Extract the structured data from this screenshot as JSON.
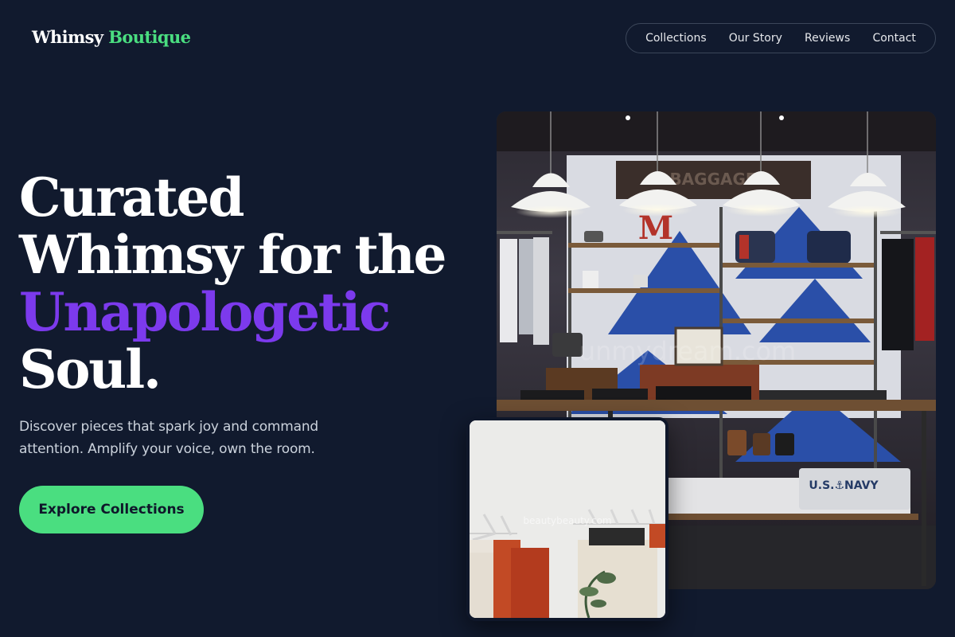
{
  "brand": {
    "name_primary": "Whimsy",
    "name_accent": "Boutique",
    "accent_color": "#4ade80"
  },
  "nav": {
    "items": [
      {
        "label": "Collections"
      },
      {
        "label": "Our Story"
      },
      {
        "label": "Reviews"
      },
      {
        "label": "Contact"
      }
    ]
  },
  "hero": {
    "headline_line1": "Curated",
    "headline_line2": "Whimsy for the",
    "headline_highlight": "Unapologetic",
    "headline_line4": "Soul.",
    "highlight_color": "#7c3aed",
    "subtext": "Discover pieces that spark joy and command attention. Amplify your voice, own the room.",
    "cta_label": "Explore Collections"
  },
  "images": {
    "store_interior": {
      "alt": "Boutique store interior with pendant lamps and shelves",
      "shelf_sign": "BAGGAGE",
      "letter_sign": "M",
      "sweater_text": "U.S.⚓NAVY",
      "watermark": "unmydream.com"
    },
    "clothing_rack": {
      "alt": "Clothing rack with garments against a white wall",
      "watermark": "beautybeauty.com"
    }
  },
  "colors": {
    "background": "#111a2e",
    "cta_background": "#4ade80",
    "nav_border": "#3b4659"
  }
}
